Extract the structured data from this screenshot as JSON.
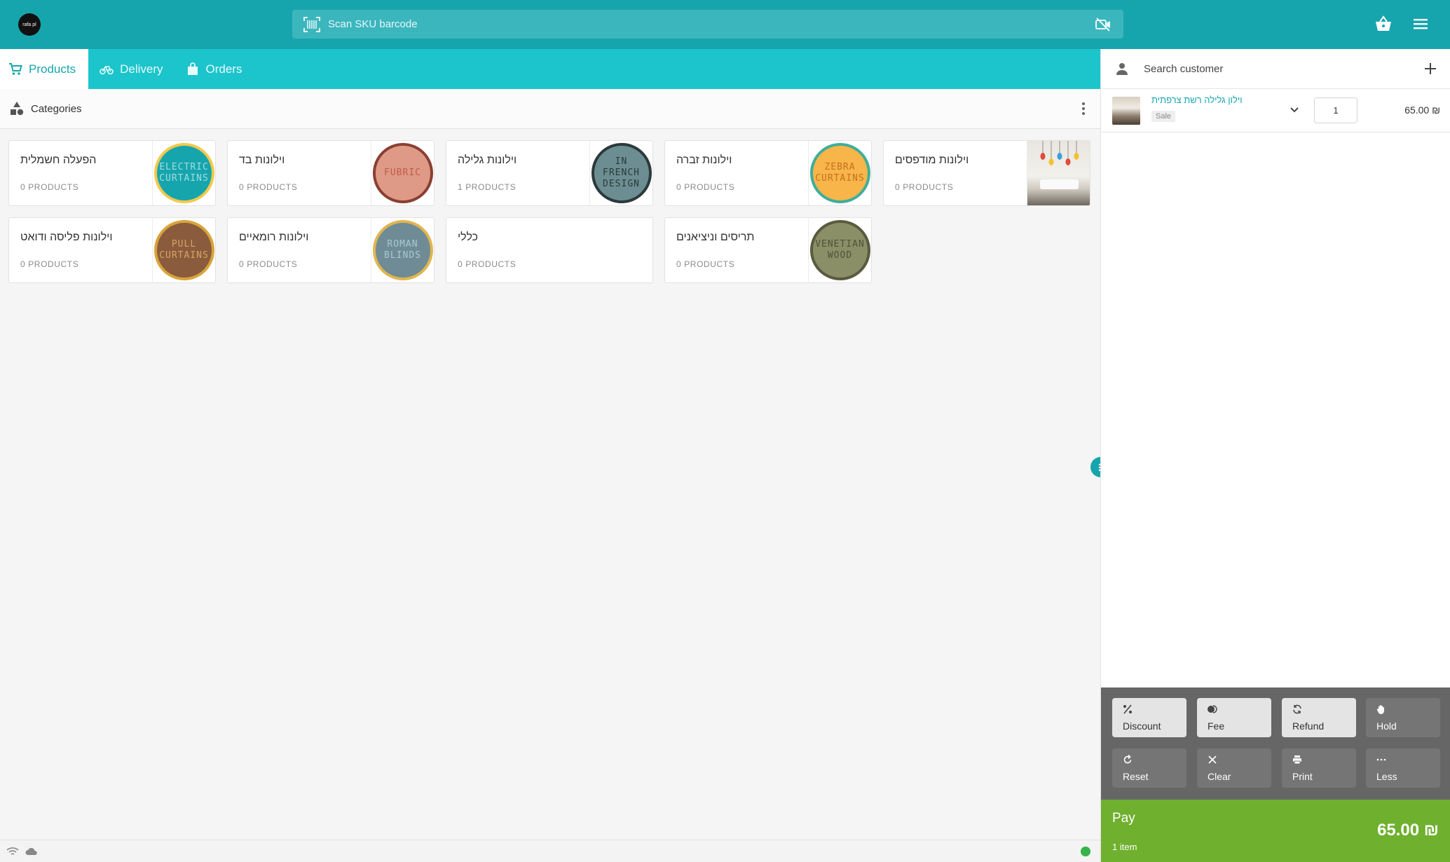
{
  "topbar": {
    "logo_text": "rafa pl",
    "scan_placeholder": "Scan SKU barcode",
    "icons": [
      "barcode-icon",
      "camera-off-icon",
      "basket-icon",
      "hamburger-menu-icon"
    ]
  },
  "tabs": [
    {
      "label": "Products",
      "icon": "cart-icon",
      "active": true
    },
    {
      "label": "Delivery",
      "icon": "bicycle-icon",
      "active": false
    },
    {
      "label": "Orders",
      "icon": "bag-icon",
      "active": false
    }
  ],
  "categories_header": {
    "title": "Categories",
    "icon": "shapes-icon"
  },
  "categories": [
    {
      "name": "הפעלה חשמלית",
      "count": "0 PRODUCTS",
      "badge_text": "ELECTRIC CURTAINS",
      "badge_bg": "#17a5ad",
      "badge_ring": "#f2c94c",
      "badge_fg": "#9fdde0"
    },
    {
      "name": "וילונות בד",
      "count": "0 PRODUCTS",
      "badge_text": "FUBRIC",
      "badge_bg": "#de9a86",
      "badge_ring": "#8a3f32",
      "badge_fg": "#c45a4a"
    },
    {
      "name": "וילונות גלילה",
      "count": "1 PRODUCTS",
      "badge_text": "IN FRENCH DESIGN",
      "badge_bg": "#6c8e92",
      "badge_ring": "#2c3a3c",
      "badge_fg": "#2c3a3c"
    },
    {
      "name": "וילונות זברה",
      "count": "0 PRODUCTS",
      "badge_text": "ZEBRA CURTAINS",
      "badge_bg": "#f7b54a",
      "badge_ring": "#3fae9a",
      "badge_fg": "#c86f20"
    },
    {
      "name": "וילונות מודפסים",
      "count": "0 PRODUCTS",
      "badge_text": "",
      "photo": true
    },
    {
      "name": "וילונות פליסה ודואט",
      "count": "0 PRODUCTS",
      "badge_text": "PULL CURTAINS",
      "badge_bg": "#8a5b3c",
      "badge_ring": "#d8a43a",
      "badge_fg": "#d6a464"
    },
    {
      "name": "וילונות רומאיים",
      "count": "0 PRODUCTS",
      "badge_text": "ROMAN BLINDS",
      "badge_bg": "#6f8c96",
      "badge_ring": "#e0b550",
      "badge_fg": "#a9c8d0"
    },
    {
      "name": "כללי",
      "count": "0 PRODUCTS",
      "badge_text": "",
      "no_thumb": true
    },
    {
      "name": "תריסים וניציאנים",
      "count": "0 PRODUCTS",
      "badge_text": "VENETIAN WOOD",
      "badge_bg": "#8b8f68",
      "badge_ring": "#5b5a3e",
      "badge_fg": "#4f5235"
    }
  ],
  "cart": {
    "customer_placeholder": "Search customer",
    "line_items": [
      {
        "name": "וילון גלילה רשת צרפתית",
        "tag": "Sale",
        "qty": "1",
        "price": "65.00 ₪"
      }
    ]
  },
  "actions": [
    {
      "label": "Discount",
      "icon": "percent-icon",
      "light": true
    },
    {
      "label": "Fee",
      "icon": "toggle-icon",
      "light": true
    },
    {
      "label": "Refund",
      "icon": "refresh-icon",
      "light": true
    },
    {
      "label": "Hold",
      "icon": "hand-icon",
      "light": false
    },
    {
      "label": "Reset",
      "icon": "reset-icon",
      "light": false
    },
    {
      "label": "Clear",
      "icon": "close-icon",
      "light": false
    },
    {
      "label": "Print",
      "icon": "printer-icon",
      "light": false
    },
    {
      "label": "Less",
      "icon": "ellipsis-icon",
      "light": false
    }
  ],
  "pay": {
    "label": "Pay",
    "items": "1 item",
    "total": "65.00 ₪"
  },
  "status": {
    "online_color": "#36b34a"
  }
}
